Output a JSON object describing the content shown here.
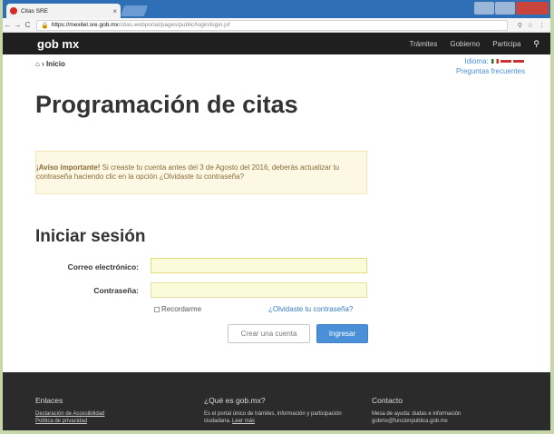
{
  "browser": {
    "tab_title": "Citas SRE",
    "tab_close": "×",
    "url_host": "https://mexitel.sre.gob.mx",
    "url_path": "/citas.webportal/pages/public/login/login.jsf"
  },
  "header": {
    "logo": "gob mx",
    "nav": [
      "Trámites",
      "Gobierno",
      "Participa"
    ],
    "search_icon": "search-icon"
  },
  "breadcrumb": {
    "home_icon": "home-icon",
    "label": "Inicio"
  },
  "lang": {
    "label": "Idioma:",
    "faq": "Preguntas frecuentes"
  },
  "page": {
    "title": "Programación de citas"
  },
  "notice": {
    "strong": "¡Aviso importante!",
    "text": "Si creaste tu cuenta antes del 3 de Agosto del 2016, deberás actualizar tu contraseña haciendo clic en la opción ¿Olvidaste tu contraseña?"
  },
  "login": {
    "title": "Iniciar sesión",
    "email_label": "Correo electrónico:",
    "password_label": "Contraseña:",
    "remember_label": "Recordarme",
    "forgot_link": "¿Olvidaste tu contraseña?",
    "create_account": "Crear una cuenta",
    "submit": "Ingresar"
  },
  "footer": {
    "col1": {
      "title": "Enlaces",
      "links": [
        "Declaración de Accesibilidad",
        "Política de privacidad"
      ]
    },
    "col2": {
      "title": "¿Qué es gob.mx?",
      "text": "Es el portal único de trámites, información y participación ciudadana.",
      "link": "Leer más"
    },
    "col3": {
      "title": "Contacto",
      "lines": [
        "Mesa de ayuda: dudas e información",
        "gobmx@funcionpublica.gob.mx"
      ]
    }
  },
  "colors": {
    "accent": "#4a90d9",
    "header_bg": "#1f1f1f",
    "notice_bg": "#fcf8e3",
    "input_bg": "#fafbd8"
  }
}
